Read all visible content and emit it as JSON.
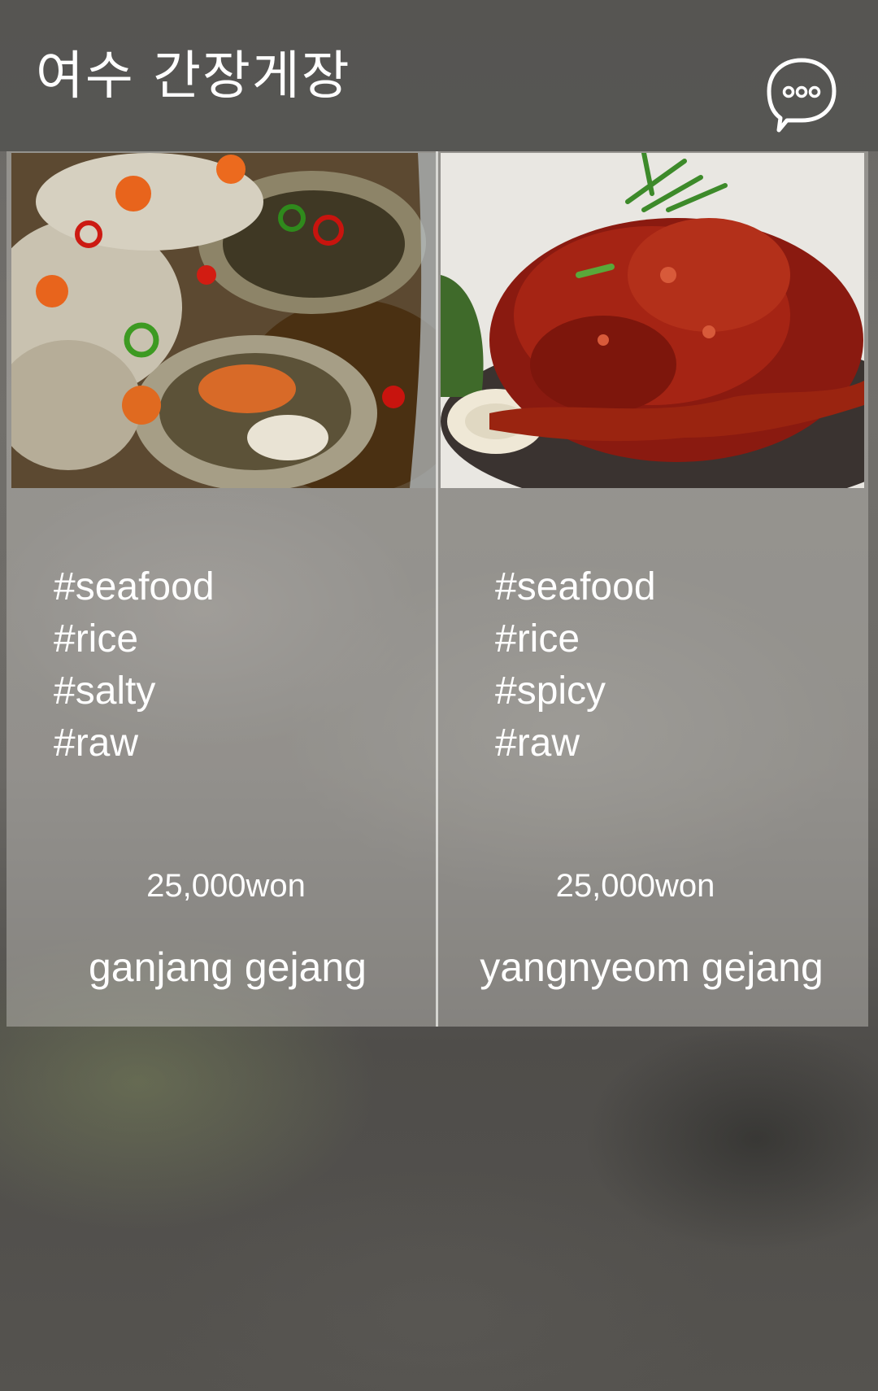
{
  "header": {
    "title": "여수 간장게장",
    "chat_button_icon": "chat-bubble-ellipsis-icon"
  },
  "menu": {
    "items": [
      {
        "image": "ganjang-gejang-photo",
        "tags": [
          "#seafood",
          "#rice",
          "#salty",
          "#raw"
        ],
        "price": "25,000won",
        "name": "ganjang gejang"
      },
      {
        "image": "yangnyeom-gejang-photo",
        "tags": [
          "#seafood",
          "#rice",
          "#spicy",
          "#raw"
        ],
        "price": "25,000won",
        "name": "yangnyeom gejang"
      }
    ]
  },
  "colors": {
    "text": "#ffffff",
    "card_overlay": "#bebcb8",
    "header_overlay": "#464644"
  }
}
